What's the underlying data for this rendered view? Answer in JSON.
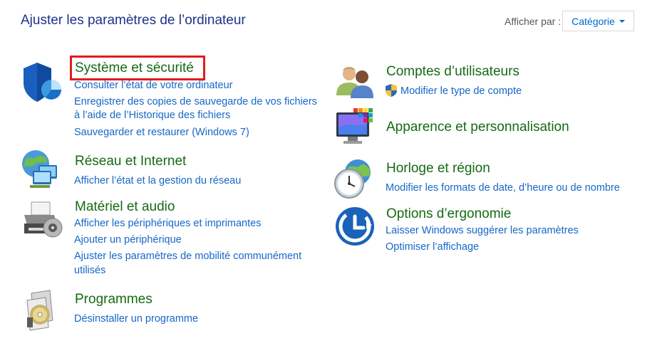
{
  "header": {
    "title": "Ajuster les paramètres de l’ordinateur",
    "view_by_label": "Afficher par :",
    "view_by_value": "Catégorie"
  },
  "categories": {
    "system": {
      "title": "Système et sécurité",
      "links": [
        "Consulter l’état de votre ordinateur",
        "Enregistrer des copies de sauvegarde de vos fichiers",
        "à l’aide de l’Historique des fichiers",
        "Sauvegarder et restaurer (Windows 7)"
      ]
    },
    "network": {
      "title": "Réseau et Internet",
      "links": [
        "Afficher l’état et la gestion du réseau"
      ]
    },
    "hardware": {
      "title": "Matériel et audio",
      "links": [
        "Afficher les périphériques et imprimantes",
        "Ajouter un périphérique",
        "Ajuster les paramètres de mobilité communément",
        "utilisés"
      ]
    },
    "programs": {
      "title": "Programmes",
      "links": [
        "Désinstaller un programme"
      ]
    },
    "accounts": {
      "title": "Comptes d’utilisateurs",
      "links": [
        "Modifier le type de compte"
      ]
    },
    "appearance": {
      "title": "Apparence et personnalisation",
      "links": []
    },
    "clock": {
      "title": "Horloge et région",
      "links": [
        "Modifier les formats de date, d’heure ou de nombre"
      ]
    },
    "ease": {
      "title": "Options d’ergonomie",
      "links": [
        "Laisser Windows suggérer les paramètres",
        "Optimiser l’affichage"
      ]
    }
  },
  "colors": {
    "title_blue": "#1e3287",
    "category_green": "#156a15",
    "link_blue": "#1667c8",
    "highlight_red": "#e01d1d"
  },
  "icons": {
    "system": "security-shield-icon",
    "network": "network-globe-icon",
    "hardware": "printer-icon",
    "programs": "programs-disc-icon",
    "accounts": "users-icon",
    "appearance": "monitor-icon",
    "clock": "clock-globe-icon",
    "ease": "ease-of-access-icon"
  }
}
